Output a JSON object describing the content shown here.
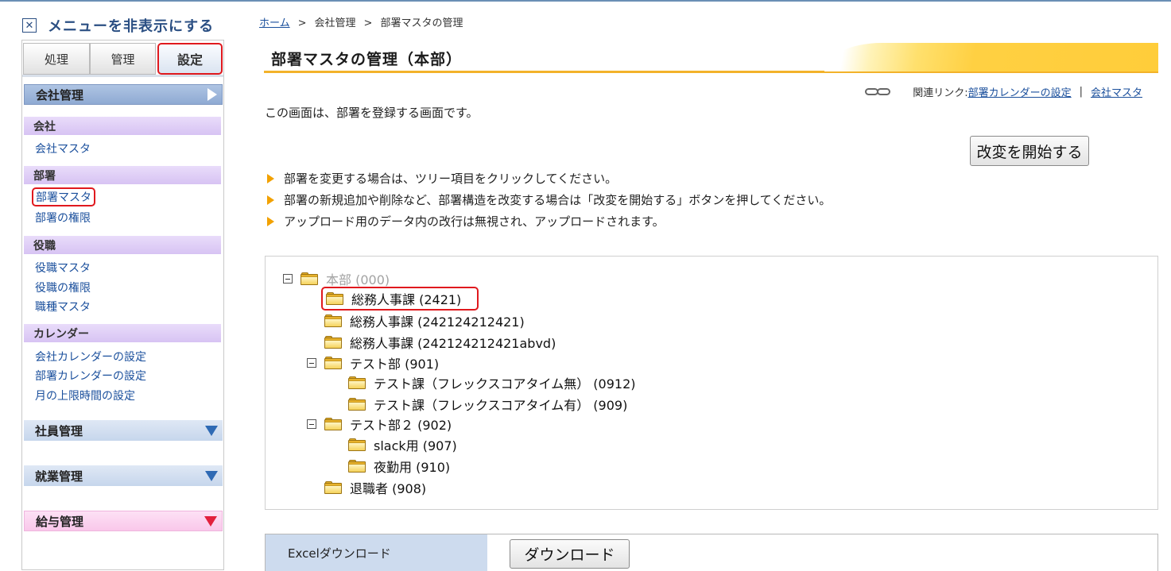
{
  "sidebar": {
    "hide_menu_label": "メニューを非表示にする",
    "tabs": [
      "処理",
      "管理",
      "設定"
    ],
    "sections": {
      "company_mgmt": "会社管理",
      "employee_mgmt": "社員管理",
      "work_mgmt": "就業管理",
      "payroll_mgmt": "給与管理"
    },
    "categories": {
      "company": "会社",
      "department": "部署",
      "position": "役職",
      "calendar": "カレンダー"
    },
    "links": {
      "company_master": "会社マスタ",
      "dept_master": "部署マスタ",
      "dept_permission": "部署の権限",
      "position_master": "役職マスタ",
      "position_permission": "役職の権限",
      "jobtype_master": "職種マスタ",
      "company_calendar": "会社カレンダーの設定",
      "dept_calendar": "部署カレンダーの設定",
      "monthly_limit": "月の上限時間の設定"
    }
  },
  "breadcrumb": {
    "home": "ホーム",
    "sep": ">",
    "level1": "会社管理",
    "level2": "部署マスタの管理"
  },
  "page_title": "部署マスタの管理（本部）",
  "related": {
    "label": "関連リンク:",
    "link1": "部署カレンダーの設定",
    "divider": "|",
    "link2": "会社マスタ"
  },
  "description": "この画面は、部署を登録する画面です。",
  "start_button": "改変を開始する",
  "notes": [
    "部署を変更する場合は、ツリー項目をクリックしてください。",
    "部署の新規追加や削除など、部署構造を改変する場合は「改変を開始する」ボタンを押してください。",
    "アップロード用のデータ内の改行は無視され、アップロードされます。"
  ],
  "tree": {
    "root": "本部 (000)",
    "n1": "総務人事課 (2421)",
    "n2": "総務人事課 (242124212421)",
    "n3": "総務人事課 (242124212421abvd)",
    "n4": "テスト部 (901)",
    "n4a": "テスト課（フレックスコアタイム無） (0912)",
    "n4b": "テスト課（フレックスコアタイム有） (909)",
    "n5": "テスト部２ (902)",
    "n5a": "slack用 (907)",
    "n5b": "夜勤用 (910)",
    "n6": "退職者 (908)"
  },
  "excel": {
    "label": "Excelダウンロード",
    "button": "ダウンロード"
  },
  "colors": {
    "accent_red": "#e0191e",
    "link_blue": "#1a4f9c",
    "title_gold": "#f3b22a"
  }
}
